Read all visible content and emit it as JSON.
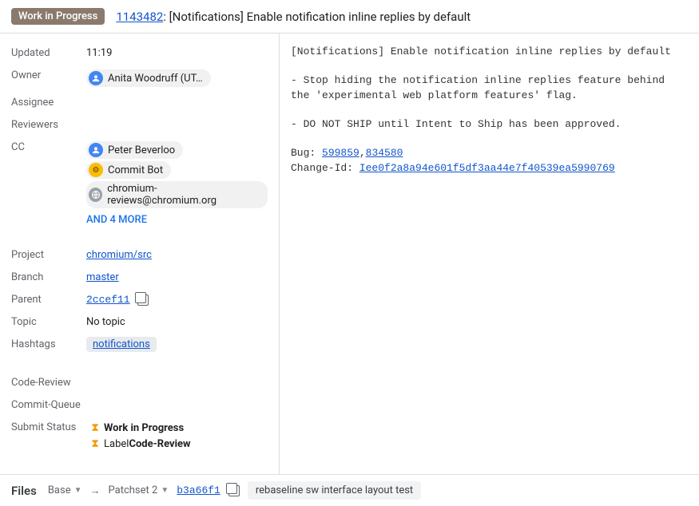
{
  "header": {
    "badge": "Work in Progress",
    "change_id": "1143482",
    "title_rest": ": [Notifications] Enable notification inline replies by default"
  },
  "meta": {
    "labels": {
      "updated": "Updated",
      "owner": "Owner",
      "assignee": "Assignee",
      "reviewers": "Reviewers",
      "cc": "CC",
      "project": "Project",
      "branch": "Branch",
      "parent": "Parent",
      "topic": "Topic",
      "hashtags": "Hashtags",
      "code_review": "Code-Review",
      "commit_queue": "Commit-Queue",
      "submit_status": "Submit Status"
    },
    "updated": "11:19",
    "owner": "Anita Woodruff (UT…",
    "cc": {
      "items": [
        "Peter Beverloo",
        "Commit Bot",
        "chromium-reviews@chromium.org"
      ],
      "more": "AND 4 MORE"
    },
    "project": "chromium/src",
    "branch": "master",
    "parent": "2ccef11",
    "topic": "No topic",
    "hashtag": "notifications",
    "submit_status": {
      "wip_prefix": "Work in Progress",
      "label_prefix": "Label ",
      "label_bold": "Code-Review"
    }
  },
  "description": {
    "title": "[Notifications] Enable notification inline replies by default",
    "body1": "- Stop hiding the notification inline replies feature behind the 'experimental web platform features' flag.",
    "body2": "- DO NOT SHIP until Intent to Ship has been approved.",
    "bug_label": "Bug: ",
    "bug1": "599859",
    "bug_sep": ",",
    "bug2": "834580",
    "changeid_label": "Change-Id: ",
    "changeid": "Iee0f2a8a94e601f5df3aa44e7f40539ea5990769"
  },
  "files_bar": {
    "title": "Files",
    "base": "Base",
    "arrow": "→",
    "patchset": "Patchset 2",
    "commit_sha": "b3a66f1",
    "commit_msg": "rebaseline sw interface layout test"
  }
}
